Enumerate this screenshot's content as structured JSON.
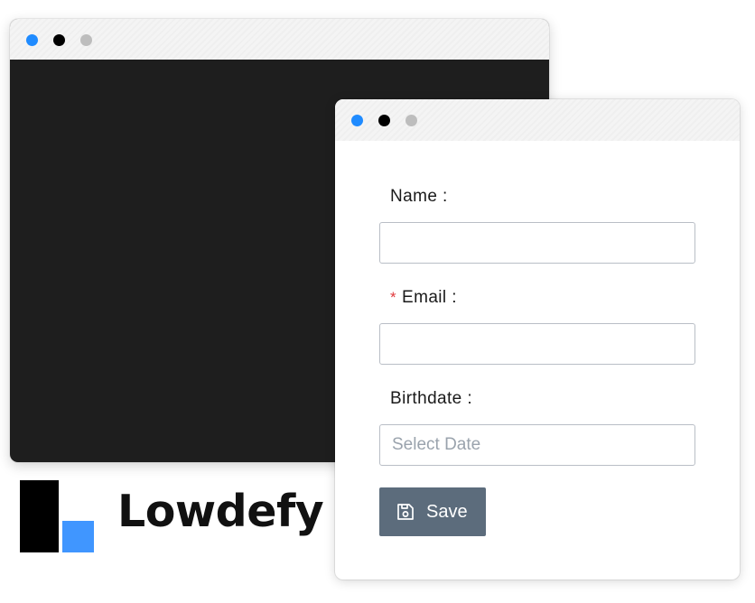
{
  "colors": {
    "dot_blue": "#1f8bff",
    "dot_black": "#000000",
    "dot_gray": "#bdbdbd",
    "back_window_background": "#1e1e1e",
    "button_background": "#5c6c7c",
    "required_mark": "#e0393c",
    "logo_blue": "#4096ff"
  },
  "form": {
    "name": {
      "label": "Name :",
      "value": "",
      "placeholder": ""
    },
    "email": {
      "required_mark": "*",
      "label": "Email :",
      "value": "",
      "placeholder": ""
    },
    "birthdate": {
      "label": "Birthdate :",
      "value": "",
      "placeholder": "Select Date"
    },
    "save_button": {
      "label": "Save",
      "icon": "save-icon"
    }
  },
  "logo": {
    "text": "Lowdefy"
  }
}
